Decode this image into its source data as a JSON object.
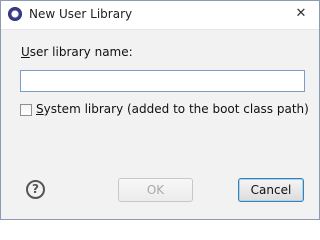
{
  "window": {
    "title": "New User Library",
    "close_glyph": "✕"
  },
  "form": {
    "name_label_mnemonic": "U",
    "name_label_rest": "ser library name:",
    "name_value": "",
    "system_library_label_mnemonic": "S",
    "system_library_label_rest": "ystem library (added to the boot class path)",
    "system_library_checked": false
  },
  "buttons": {
    "help_glyph": "?",
    "ok_label": "OK",
    "ok_enabled": false,
    "cancel_label": "Cancel"
  },
  "icons": {
    "app": "eclipse-icon",
    "help": "help-icon"
  }
}
